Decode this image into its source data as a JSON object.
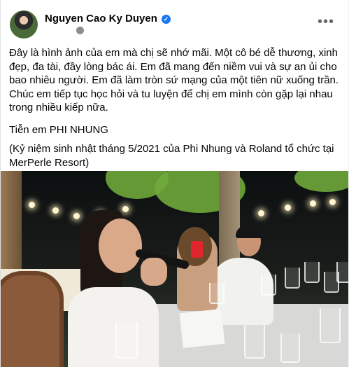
{
  "post": {
    "author": "Nguyen Cao Ky Duyen",
    "paragraphs": [
      "Đây là hình ảnh của em mà chị sẽ nhớ mãi.  Một cô bé dễ thương, xinh đẹp, đa tài, đầy lòng bác ái.  Em đã mang đến niềm vui và sự an ủi cho bao nhiêu người.  Em đã làm tròn sứ mạng của một tiên nữ xuống trần.  Chúc em tiếp tục học hỏi và tu luyện để chị em mình còn gặp lại nhau trong nhiều kiếp nữa.",
      "Tiễn em PHI NHUNG",
      "(Kỷ niệm sinh nhật tháng 5/2021 của Phi Nhung và Roland tổ chức tại MerPerle Resort)"
    ]
  },
  "icons": {
    "verified": "verified-badge-icon",
    "privacy": "globe-icon",
    "more": "more-options-icon"
  },
  "colors": {
    "accent": "#1877f2",
    "text": "#050505",
    "muted": "#65676b"
  }
}
